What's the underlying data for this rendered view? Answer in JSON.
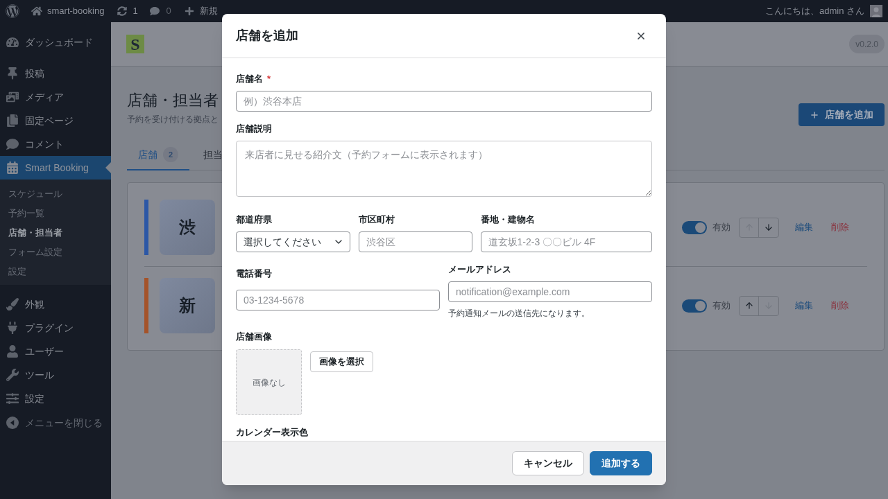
{
  "admin_bar": {
    "site_name": "smart-booking",
    "updates_count": "1",
    "comments_count": "0",
    "new_label": "新規",
    "greeting": "こんにちは、admin さん"
  },
  "sidebar": {
    "groups": [
      {
        "items": [
          {
            "label": "ダッシュボード",
            "selected": false
          }
        ]
      },
      {
        "items": [
          {
            "label": "投稿",
            "selected": false
          },
          {
            "label": "メディア",
            "selected": false
          },
          {
            "label": "固定ページ",
            "selected": false
          },
          {
            "label": "コメント",
            "selected": false
          },
          {
            "label": "Smart Booking",
            "selected": true,
            "children": [
              {
                "label": "スケジュール",
                "selected": false
              },
              {
                "label": "予約一覧",
                "selected": false
              },
              {
                "label": "店舗・担当者",
                "selected": true
              },
              {
                "label": "フォーム設定",
                "selected": false
              },
              {
                "label": "設定",
                "selected": false
              }
            ]
          }
        ]
      },
      {
        "items": [
          {
            "label": "外観",
            "selected": false
          },
          {
            "label": "プラグイン",
            "selected": false
          },
          {
            "label": "ユーザー",
            "selected": false
          },
          {
            "label": "ツール",
            "selected": false
          },
          {
            "label": "設定",
            "selected": false
          }
        ]
      }
    ],
    "collapse_label": "メニューを閉じる"
  },
  "plugin_header": {
    "logo": "S",
    "version": "v0.2.0"
  },
  "page": {
    "title": "店舗・担当者",
    "subtitle": "予約を受け付ける拠点と",
    "add_button": "店舗を追加"
  },
  "tabs": [
    {
      "label": "店舗",
      "count": "2",
      "selected": true
    },
    {
      "label": "担当",
      "selected": false
    }
  ],
  "stores": [
    {
      "color": "#2c57a6",
      "initial": "渋",
      "enabled": true,
      "status_label": "有効",
      "move_up_disabled": true,
      "move_down_disabled": false,
      "edit_label": "編集",
      "delete_label": "削除"
    },
    {
      "color": "#a4532a",
      "initial": "新",
      "enabled": true,
      "status_label": "有効",
      "move_up_disabled": false,
      "move_down_disabled": true,
      "edit_label": "編集",
      "delete_label": "削除"
    }
  ],
  "dialog": {
    "title": "店舗を追加",
    "name_field": {
      "label": "店舗名",
      "required_mark": "*",
      "placeholder": "例）渋谷本店"
    },
    "description_field": {
      "label": "店舗説明",
      "placeholder": "来店者に見せる紹介文（予約フォームに表示されます）"
    },
    "address_fields": [
      {
        "kind": "select",
        "label": "都道府県",
        "value": "選択してください"
      },
      {
        "kind": "text",
        "label": "市区町村",
        "placeholder": "渋谷区"
      },
      {
        "kind": "text",
        "label": "番地・建物名",
        "placeholder": "道玄坂1-2-3 〇〇ビル 4F"
      }
    ],
    "phone_field": {
      "label": "電話番号",
      "placeholder": "03-1234-5678"
    },
    "email_field": {
      "label": "メールアドレス",
      "placeholder": "notification@example.com",
      "help": "予約通知メールの送信先になります。"
    },
    "image_field": {
      "label": "店舗画像",
      "empty_text": "画像なし",
      "button": "画像を選択"
    },
    "color_field": {
      "label": "カレンダー表示色"
    },
    "buttons": [
      {
        "kind": "secondary",
        "label": "キャンセル"
      },
      {
        "kind": "primary",
        "label": "追加する"
      }
    ]
  }
}
